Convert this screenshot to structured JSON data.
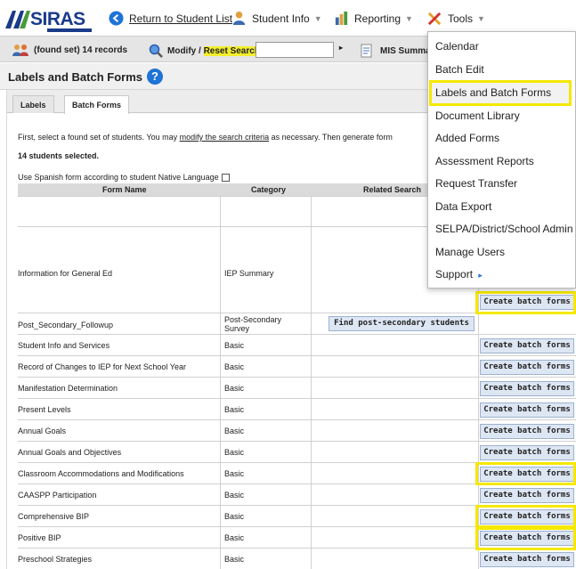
{
  "nav": {
    "logo_text": "SIRAS",
    "return_label": "Return to Student List",
    "student_info_label": "Student Info",
    "reporting_label": "Reporting",
    "tools_label": "Tools"
  },
  "toolbar": {
    "found_set_label": "(found set) 14 records",
    "modify_label": "Modify /",
    "reset_search_label": "Reset Search",
    "search_value": "",
    "mis_summary_label": "MIS Summary"
  },
  "page": {
    "title": "Labels and Batch Forms",
    "tabs": [
      "Labels",
      "Batch Forms"
    ],
    "instruction_prefix": "First, select a found set of students. You may ",
    "instruction_link": "modify the search criteria",
    "instruction_suffix": " as necessary. Then generate form",
    "students_selected": "14 students selected.",
    "spanish_option": "Use Spanish form according to student Native Language"
  },
  "table": {
    "headers": [
      "Form Name",
      "Category",
      "Related Search"
    ],
    "rows": [
      {
        "name": "Information for General Ed",
        "category": "IEP Summary",
        "button": "Create batch forms"
      },
      {
        "name": "Post_Secondary_Followup",
        "category": "Post-Secondary Survey",
        "search_button": "Find post-secondary students"
      },
      {
        "name": "Student Info and Services",
        "category": "Basic",
        "button": "Create batch forms"
      },
      {
        "name": "Record of Changes to IEP for Next School Year",
        "category": "Basic",
        "button": "Create batch forms"
      },
      {
        "name": "Manifestation Determination",
        "category": "Basic",
        "button": "Create batch forms"
      },
      {
        "name": "Present Levels",
        "category": "Basic",
        "button": "Create batch forms"
      },
      {
        "name": "Annual Goals",
        "category": "Basic",
        "button": "Create batch forms"
      },
      {
        "name": "Annual Goals and Objectives",
        "category": "Basic",
        "button": "Create batch forms"
      },
      {
        "name": "Classroom Accommodations and Modifications",
        "category": "Basic",
        "button": "Create batch forms"
      },
      {
        "name": "CAASPP Participation",
        "category": "Basic",
        "button": "Create batch forms"
      },
      {
        "name": "Comprehensive BIP",
        "category": "Basic",
        "button": "Create batch forms"
      },
      {
        "name": "Positive BIP",
        "category": "Basic",
        "button": "Create batch forms"
      },
      {
        "name": "Preschool Strategies",
        "category": "Basic",
        "button": "Create batch forms"
      }
    ]
  },
  "tools_menu": {
    "items": [
      "Calendar",
      "Batch Edit",
      "Labels and Batch Forms",
      "Document Library",
      "Added Forms",
      "Assessment Reports",
      "Request Transfer",
      "Data Export",
      "SELPA/District/School Admin",
      "Manage Users",
      "Support"
    ],
    "selected": "Labels and Batch Forms"
  },
  "colors": {
    "highlight": "#f5e800",
    "button_bg": "#dde6f3",
    "accent_blue": "#1e73d6"
  }
}
